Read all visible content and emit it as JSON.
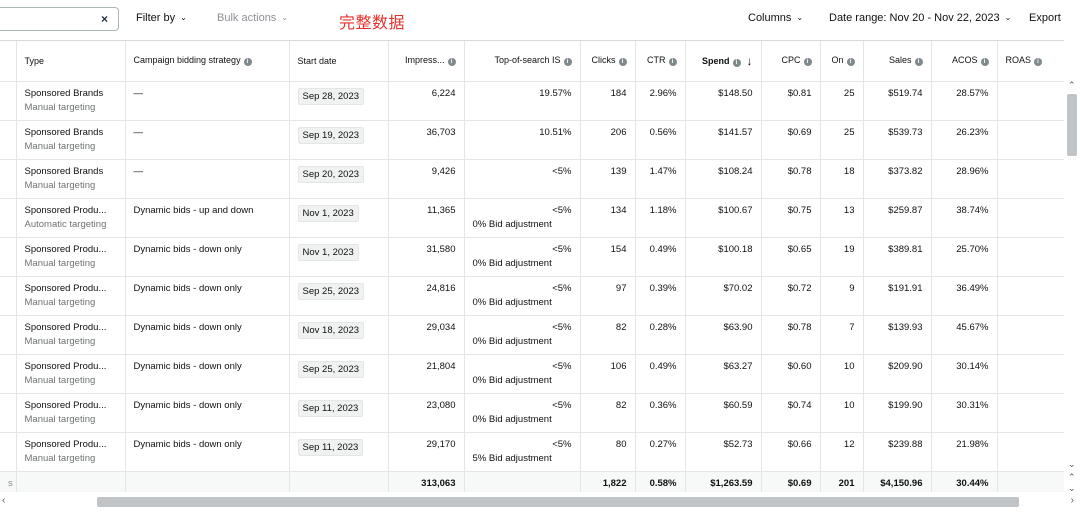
{
  "toolbar": {
    "search_clear": "×",
    "filter_by": "Filter by",
    "bulk_actions": "Bulk actions",
    "overlay_note": "完整数据",
    "columns": "Columns",
    "date_range": "Date range: Nov 20 - Nov 22, 2023",
    "export": "Export",
    "chevron": "⌄"
  },
  "columns": [
    {
      "label": "",
      "info": false
    },
    {
      "label": "Type",
      "info": false
    },
    {
      "label": "Campaign bidding strategy",
      "info": true
    },
    {
      "label": "Start date",
      "info": false
    },
    {
      "label": "Impress...",
      "info": true
    },
    {
      "label": "Top-of-search IS",
      "info": true
    },
    {
      "label": "Clicks",
      "info": true
    },
    {
      "label": "CTR",
      "info": true
    },
    {
      "label": "Spend",
      "info": true,
      "sorted": "desc"
    },
    {
      "label": "CPC",
      "info": true
    },
    {
      "label": "On",
      "info": true
    },
    {
      "label": "Sales",
      "info": true
    },
    {
      "label": "ACOS",
      "info": true
    },
    {
      "label": "ROAS",
      "info": true
    }
  ],
  "rows": [
    {
      "type": "Sponsored Brands",
      "targeting": "Manual targeting",
      "strategy": "—",
      "start": "Sep 28, 2023",
      "impressions": "6,224",
      "tos": "19.57%",
      "bid_adj": "",
      "clicks": "184",
      "ctr": "2.96%",
      "spend": "$148.50",
      "cpc": "$0.81",
      "orders": "25",
      "sales": "$519.74",
      "acos": "28.57%",
      "roas": ""
    },
    {
      "type": "Sponsored Brands",
      "targeting": "Manual targeting",
      "strategy": "—",
      "start": "Sep 19, 2023",
      "impressions": "36,703",
      "tos": "10.51%",
      "bid_adj": "",
      "clicks": "206",
      "ctr": "0.56%",
      "spend": "$141.57",
      "cpc": "$0.69",
      "orders": "25",
      "sales": "$539.73",
      "acos": "26.23%",
      "roas": ""
    },
    {
      "type": "Sponsored Brands",
      "targeting": "Manual targeting",
      "strategy": "—",
      "start": "Sep 20, 2023",
      "impressions": "9,426",
      "tos": "<5%",
      "bid_adj": "",
      "clicks": "139",
      "ctr": "1.47%",
      "spend": "$108.24",
      "cpc": "$0.78",
      "orders": "18",
      "sales": "$373.82",
      "acos": "28.96%",
      "roas": ""
    },
    {
      "type": "Sponsored Produ...",
      "targeting": "Automatic targeting",
      "strategy": "Dynamic bids - up and down",
      "start": "Nov 1, 2023",
      "impressions": "11,365",
      "tos": "<5%",
      "bid_adj": "0% Bid adjustment",
      "clicks": "134",
      "ctr": "1.18%",
      "spend": "$100.67",
      "cpc": "$0.75",
      "orders": "13",
      "sales": "$259.87",
      "acos": "38.74%",
      "roas": ""
    },
    {
      "type": "Sponsored Produ...",
      "targeting": "Manual targeting",
      "strategy": "Dynamic bids - down only",
      "start": "Nov 1, 2023",
      "impressions": "31,580",
      "tos": "<5%",
      "bid_adj": "0% Bid adjustment",
      "clicks": "154",
      "ctr": "0.49%",
      "spend": "$100.18",
      "cpc": "$0.65",
      "orders": "19",
      "sales": "$389.81",
      "acos": "25.70%",
      "roas": ""
    },
    {
      "type": "Sponsored Produ...",
      "targeting": "Manual targeting",
      "strategy": "Dynamic bids - down only",
      "start": "Sep 25, 2023",
      "impressions": "24,816",
      "tos": "<5%",
      "bid_adj": "0% Bid adjustment",
      "clicks": "97",
      "ctr": "0.39%",
      "spend": "$70.02",
      "cpc": "$0.72",
      "orders": "9",
      "sales": "$191.91",
      "acos": "36.49%",
      "roas": ""
    },
    {
      "type": "Sponsored Produ...",
      "targeting": "Manual targeting",
      "strategy": "Dynamic bids - down only",
      "start": "Nov 18, 2023",
      "impressions": "29,034",
      "tos": "<5%",
      "bid_adj": "0% Bid adjustment",
      "clicks": "82",
      "ctr": "0.28%",
      "spend": "$63.90",
      "cpc": "$0.78",
      "orders": "7",
      "sales": "$139.93",
      "acos": "45.67%",
      "roas": ""
    },
    {
      "type": "Sponsored Produ...",
      "targeting": "Manual targeting",
      "strategy": "Dynamic bids - down only",
      "start": "Sep 25, 2023",
      "impressions": "21,804",
      "tos": "<5%",
      "bid_adj": "0% Bid adjustment",
      "clicks": "106",
      "ctr": "0.49%",
      "spend": "$63.27",
      "cpc": "$0.60",
      "orders": "10",
      "sales": "$209.90",
      "acos": "30.14%",
      "roas": ""
    },
    {
      "type": "Sponsored Produ...",
      "targeting": "Manual targeting",
      "strategy": "Dynamic bids - down only",
      "start": "Sep 11, 2023",
      "impressions": "23,080",
      "tos": "<5%",
      "bid_adj": "0% Bid adjustment",
      "clicks": "82",
      "ctr": "0.36%",
      "spend": "$60.59",
      "cpc": "$0.74",
      "orders": "10",
      "sales": "$199.90",
      "acos": "30.31%",
      "roas": ""
    },
    {
      "type": "Sponsored Produ...",
      "targeting": "Manual targeting",
      "strategy": "Dynamic bids - down only",
      "start": "Sep 11, 2023",
      "impressions": "29,170",
      "tos": "<5%",
      "bid_adj": "5% Bid adjustment",
      "clicks": "80",
      "ctr": "0.27%",
      "spend": "$52.73",
      "cpc": "$0.66",
      "orders": "12",
      "sales": "$239.88",
      "acos": "21.98%",
      "roas": ""
    }
  ],
  "totals": {
    "first": "s",
    "impressions": "313,063",
    "clicks": "1,822",
    "ctr": "0.58%",
    "spend": "$1,263.59",
    "cpc": "$0.69",
    "orders": "201",
    "sales": "$4,150.96",
    "acos": "30.44%",
    "roas": ""
  }
}
